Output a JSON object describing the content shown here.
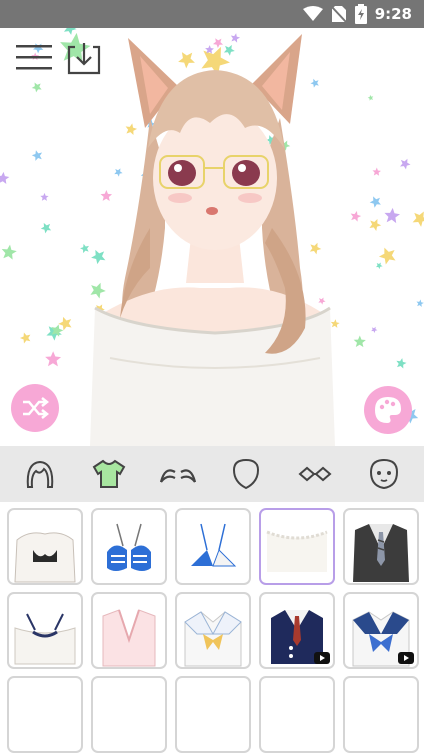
{
  "status_bar": {
    "time": "9:28",
    "icons": [
      "wifi-icon",
      "no-sim-icon",
      "battery-charging-icon"
    ]
  },
  "toolbar": {
    "menu_icon": "hamburger-menu-icon",
    "save_icon": "download-icon"
  },
  "canvas": {
    "character": "anime-girl-cat-ears",
    "background_pattern": "pastel-stars",
    "shuffle_icon": "shuffle-icon",
    "palette_icon": "palette-icon"
  },
  "categories": [
    {
      "id": "hair",
      "icon": "hair-icon",
      "selected": false
    },
    {
      "id": "clothes",
      "icon": "shirt-icon",
      "selected": true
    },
    {
      "id": "eyebrows",
      "icon": "eyebrows-icon",
      "selected": false
    },
    {
      "id": "face",
      "icon": "face-shape-icon",
      "selected": false
    },
    {
      "id": "glasses",
      "icon": "glasses-icon",
      "selected": false
    },
    {
      "id": "expression",
      "icon": "face-expression-icon",
      "selected": false
    }
  ],
  "items": [
    {
      "id": "open-shirt-black-bra",
      "selected": false,
      "video_locked": false
    },
    {
      "id": "blue-striped-bikini",
      "selected": false,
      "video_locked": false
    },
    {
      "id": "blue-white-bikini",
      "selected": false,
      "video_locked": false
    },
    {
      "id": "white-ruffle-top",
      "selected": true,
      "video_locked": false
    },
    {
      "id": "gray-vest-striped-tie",
      "selected": false,
      "video_locked": false
    },
    {
      "id": "white-offshoulder-navy",
      "selected": false,
      "video_locked": false
    },
    {
      "id": "pink-robe",
      "selected": false,
      "video_locked": false
    },
    {
      "id": "sailor-yellow-bow",
      "selected": false,
      "video_locked": false
    },
    {
      "id": "navy-vest-red-tie",
      "selected": false,
      "video_locked": true
    },
    {
      "id": "sailor-blue-bow",
      "selected": false,
      "video_locked": true
    },
    {
      "id": "item-11",
      "selected": false,
      "video_locked": false
    },
    {
      "id": "item-12",
      "selected": false,
      "video_locked": false
    },
    {
      "id": "item-13",
      "selected": false,
      "video_locked": false
    },
    {
      "id": "item-14",
      "selected": false,
      "video_locked": false
    },
    {
      "id": "item-15",
      "selected": false,
      "video_locked": false
    }
  ],
  "colors": {
    "accent_pink": "#f7a8d6",
    "selected_border": "#b89ee8",
    "tab_bar": "#e8e8e8",
    "status_bar": "#757575",
    "selected_tab_icon": "#a8e6a0"
  }
}
